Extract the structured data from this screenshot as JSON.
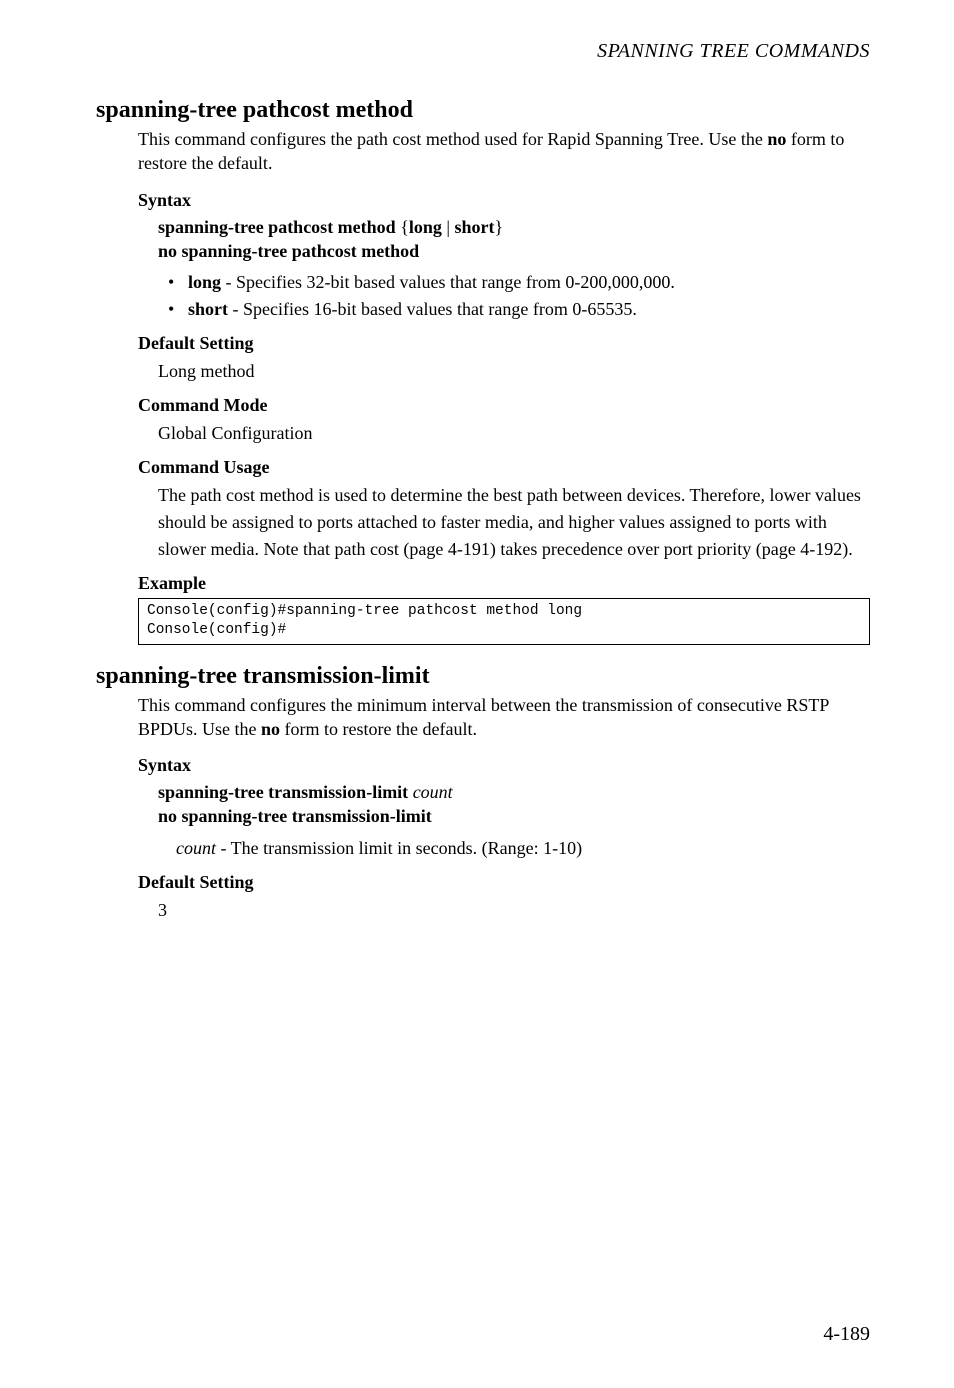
{
  "running_head": "SPANNING TREE COMMANDS",
  "s1": {
    "title": "spanning-tree pathcost method",
    "intro_a": "This command configures the path cost method used for Rapid Spanning Tree. Use the ",
    "intro_bold": "no",
    "intro_b": " form to restore the default.",
    "syntax_head": "Syntax",
    "syntax_line1_a": "spanning-tree pathcost method",
    "syntax_line1_b": " {",
    "syntax_line1_c": "long",
    "syntax_line1_d": " | ",
    "syntax_line1_e": "short",
    "syntax_line1_f": "}",
    "syntax_line2": "no spanning-tree pathcost method",
    "bullets": [
      {
        "kw": "long",
        "rest": " - Specifies 32-bit based values that range from 0-200,000,000."
      },
      {
        "kw": "short",
        "rest": " - Specifies 16-bit based values that range from 0-65535."
      }
    ],
    "default_head": "Default Setting",
    "default_text": "Long method",
    "mode_head": "Command Mode",
    "mode_text": "Global Configuration",
    "usage_head": "Command Usage",
    "usage_text": "The path cost method is used to determine the best path between devices. Therefore, lower values should be assigned to ports attached to faster media, and higher values assigned to ports with slower media. Note that path cost (page 4-191) takes precedence over port priority (page 4-192).",
    "example_head": "Example",
    "example_code": "Console(config)#spanning-tree pathcost method long\nConsole(config)#"
  },
  "s2": {
    "title": "spanning-tree transmission-limit",
    "intro_a": "This command configures the minimum interval between the transmission of consecutive RSTP BPDUs. Use the ",
    "intro_bold": "no",
    "intro_b": " form to restore the default.",
    "syntax_head": "Syntax",
    "syntax_line1_a": "spanning-tree transmission-limit ",
    "syntax_line1_it": "count",
    "syntax_line2": "no spanning-tree transmission-limit",
    "param_it": "count",
    "param_rest": " - The transmission limit in seconds. (Range: 1-10)",
    "default_head": "Default Setting",
    "default_text": "3"
  },
  "page_num": "4-189"
}
